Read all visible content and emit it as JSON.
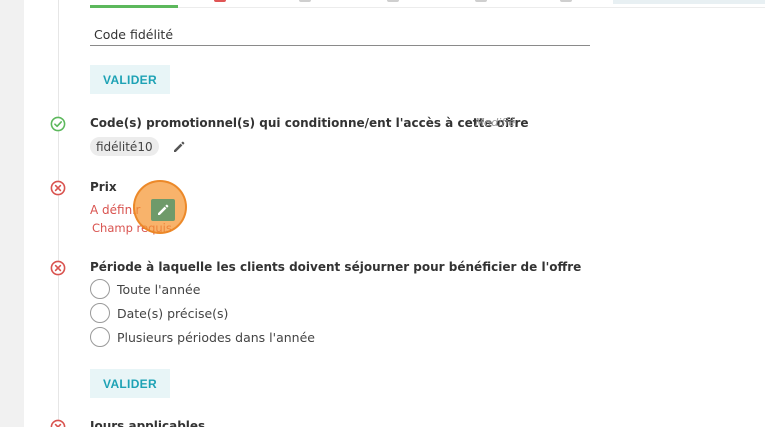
{
  "loyalty_code": {
    "label": "Code fidélité",
    "validate_label": "VALIDER"
  },
  "promo_section": {
    "title": "Code(s) promotionnel(s) qui conditionne/ent l'accès à cette offre",
    "status_text": "Modifié",
    "chip": "fidélité10"
  },
  "price_section": {
    "title": "Prix",
    "value_text": "A définir",
    "error_text": "Champ requis"
  },
  "period_section": {
    "title": "Période à laquelle les clients doivent séjourner pour bénéficier de l'offre",
    "options": [
      {
        "label": "Toute l'année",
        "selected": false
      },
      {
        "label": "Date(s) précise(s)",
        "selected": false
      },
      {
        "label": "Plusieurs périodes dans l'année",
        "selected": false
      }
    ],
    "validate_label": "VALIDER"
  },
  "days_section": {
    "title": "Jours applicables"
  },
  "colors": {
    "success": "#5cb85c",
    "error": "#d9534f",
    "accent": "#1ea2b5",
    "click_highlight": "#f59632"
  },
  "icons": {
    "valid": "check-circle-icon",
    "invalid": "x-circle-icon",
    "edit": "pencil-icon"
  }
}
